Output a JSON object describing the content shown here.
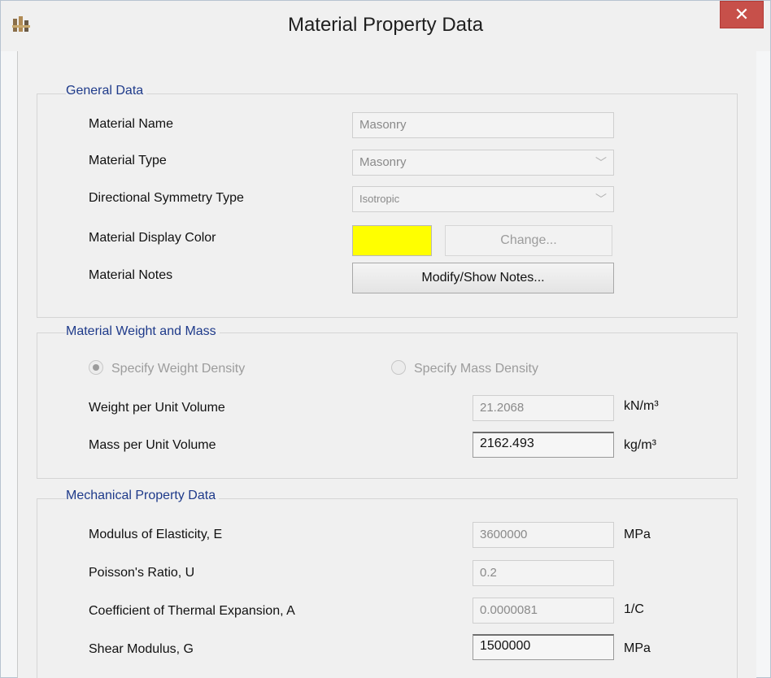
{
  "window": {
    "title": "Material Property Data",
    "close_label": "✕"
  },
  "general": {
    "title": "General Data",
    "material_name_label": "Material Name",
    "material_name_value": "Masonry",
    "material_type_label": "Material Type",
    "material_type_value": "Masonry",
    "symmetry_label": "Directional Symmetry Type",
    "symmetry_value": "Isotropic",
    "display_color_label": "Material Display Color",
    "display_color": "#ffff00",
    "change_label": "Change...",
    "notes_label": "Material Notes",
    "notes_button": "Modify/Show Notes..."
  },
  "weight": {
    "title": "Material Weight and Mass",
    "weight_density_option": "Specify Weight Density",
    "mass_density_option": "Specify Mass Density",
    "weight_density_selected": true,
    "weight_label": "Weight per Unit Volume",
    "weight_value": "21.2068",
    "weight_unit": "kN/m³",
    "mass_label": "Mass per Unit Volume",
    "mass_value": "2162.493",
    "mass_unit": "kg/m³"
  },
  "mechanical": {
    "title": "Mechanical Property Data",
    "e_label": "Modulus of Elasticity,  E",
    "e_value": "3600000",
    "e_unit": "MPa",
    "u_label": "Poisson's Ratio,  U",
    "u_value": "0.2",
    "a_label": "Coefficient of Thermal Expansion,  A",
    "a_value": "0.0000081",
    "a_unit": "1/C",
    "g_label": "Shear Modulus,  G",
    "g_value": "1500000",
    "g_unit": "MPa"
  }
}
